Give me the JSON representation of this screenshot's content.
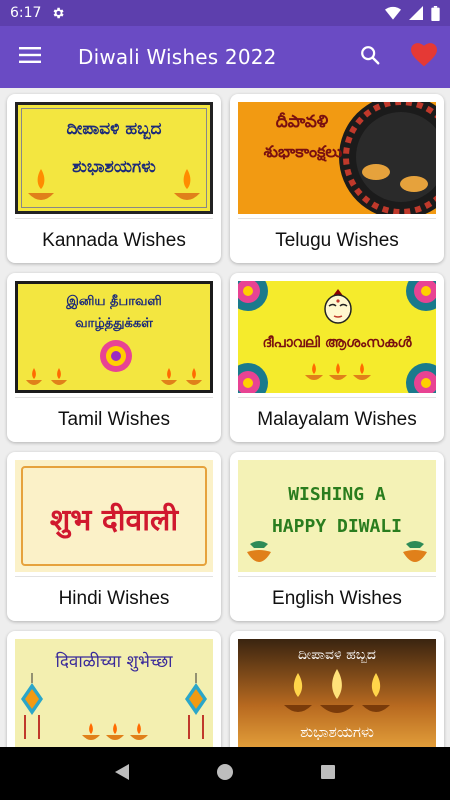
{
  "status_bar": {
    "time": "6:17"
  },
  "app_bar": {
    "title": "Diwali Wishes 2022"
  },
  "colors": {
    "status_bar": "#5d3fad",
    "app_bar": "#6a4bc4",
    "favorite": "#e53935"
  },
  "cards": [
    {
      "label": "Kannada Wishes",
      "thumb_text": [
        "ದೀಪಾವಳಿ ಹಬ್ಬದ",
        "ಶುಭಾಶಯಗಳು"
      ]
    },
    {
      "label": "Telugu Wishes",
      "thumb_text": [
        "దీపావళి",
        "శుభాకాంక్షలు"
      ]
    },
    {
      "label": "Tamil Wishes",
      "thumb_text": [
        "இனிய தீபாவளி",
        "வாழ்த்துக்கள்"
      ]
    },
    {
      "label": "Malayalam Wishes",
      "thumb_text": [
        "ദീപാവലി ആശംസകൾ"
      ]
    },
    {
      "label": "Hindi Wishes",
      "thumb_text": [
        "शुभ दीवाली"
      ]
    },
    {
      "label": "English Wishes",
      "thumb_text": [
        "WISHING A",
        "HAPPY DIWALI"
      ]
    },
    {
      "label": "",
      "thumb_text": [
        "दिवाळीच्या शुभेच्छा"
      ]
    },
    {
      "label": "",
      "thumb_text": [
        "ದೀಪಾವಳಿ ಹಬ್ಬದ",
        "ಶುಭಾಶಯಗಳು"
      ]
    }
  ],
  "icons": {
    "status": [
      "settings-icon",
      "wifi-icon",
      "signal-icon",
      "battery-icon"
    ],
    "app_bar": [
      "menu-icon",
      "search-icon",
      "heart-icon"
    ],
    "nav": [
      "back-icon",
      "home-icon",
      "recents-icon"
    ]
  }
}
